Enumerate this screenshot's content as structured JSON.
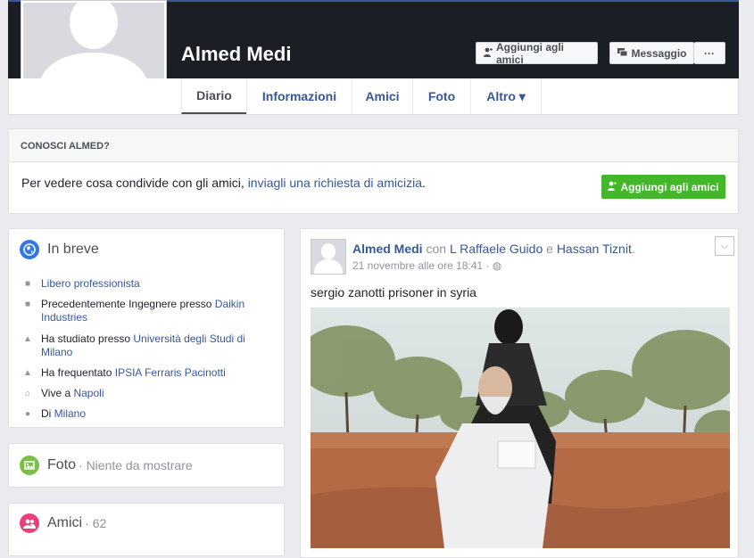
{
  "profile": {
    "name": "Almed Medi",
    "add_friend_label": "Aggiungi agli amici",
    "message_label": "Messaggio",
    "more_label": "···"
  },
  "tabs": [
    {
      "label": "Diario",
      "active": true
    },
    {
      "label": "Informazioni"
    },
    {
      "label": "Amici"
    },
    {
      "label": "Foto"
    },
    {
      "label": "Altro ▾"
    }
  ],
  "conosci": {
    "title": "CONOSCI ALMED?",
    "text": "Per vedere cosa condivide con gli amici, ",
    "link": "inviagli una richiesta di amicizia",
    "link_suffix": ".",
    "button": "Aggiungi agli amici"
  },
  "in_breve": {
    "title": "In breve",
    "items": [
      {
        "icon": "briefcase-icon",
        "text": "",
        "link": "Libero professionista",
        "text2": ""
      },
      {
        "icon": "briefcase-icon",
        "text": "Precedentemente Ingegnere presso ",
        "link": "Daikin Industries",
        "text2": ""
      },
      {
        "icon": "graduation-cap-icon",
        "text": "Ha studiato presso ",
        "link": "Università degli Studi di Milano",
        "text2": ""
      },
      {
        "icon": "graduation-cap-icon",
        "text": "Ha frequentato ",
        "link": "IPSIA Ferraris Pacinotti",
        "text2": ""
      },
      {
        "icon": "home-icon",
        "text": "Vive a ",
        "link": "Napoli",
        "text2": ""
      },
      {
        "icon": "location-pin-icon",
        "text": "Di ",
        "link": "Milano",
        "text2": ""
      }
    ]
  },
  "foto_box": {
    "title": "Foto",
    "subtitle": "· Niente da mostrare"
  },
  "amici_box": {
    "title": "Amici",
    "count": "· 62"
  },
  "post": {
    "author": "Almed Medi",
    "with_text": " con ",
    "tagged1": "L Raffaele Guido",
    "and_text": " e ",
    "tagged2": "Hassan Tiznit",
    "tail": ".",
    "date": "21 novembre alle ore 18:41 · ",
    "privacy_icon": "globe-icon",
    "text": "sergio zanotti prisoner in syria"
  },
  "colors": {
    "link": "#365899",
    "green": "#42b72a",
    "cover": "#1c1e26",
    "in_breve_icon": "#3578e5",
    "foto_icon": "#7bc043",
    "amici_icon": "#e9407a"
  }
}
